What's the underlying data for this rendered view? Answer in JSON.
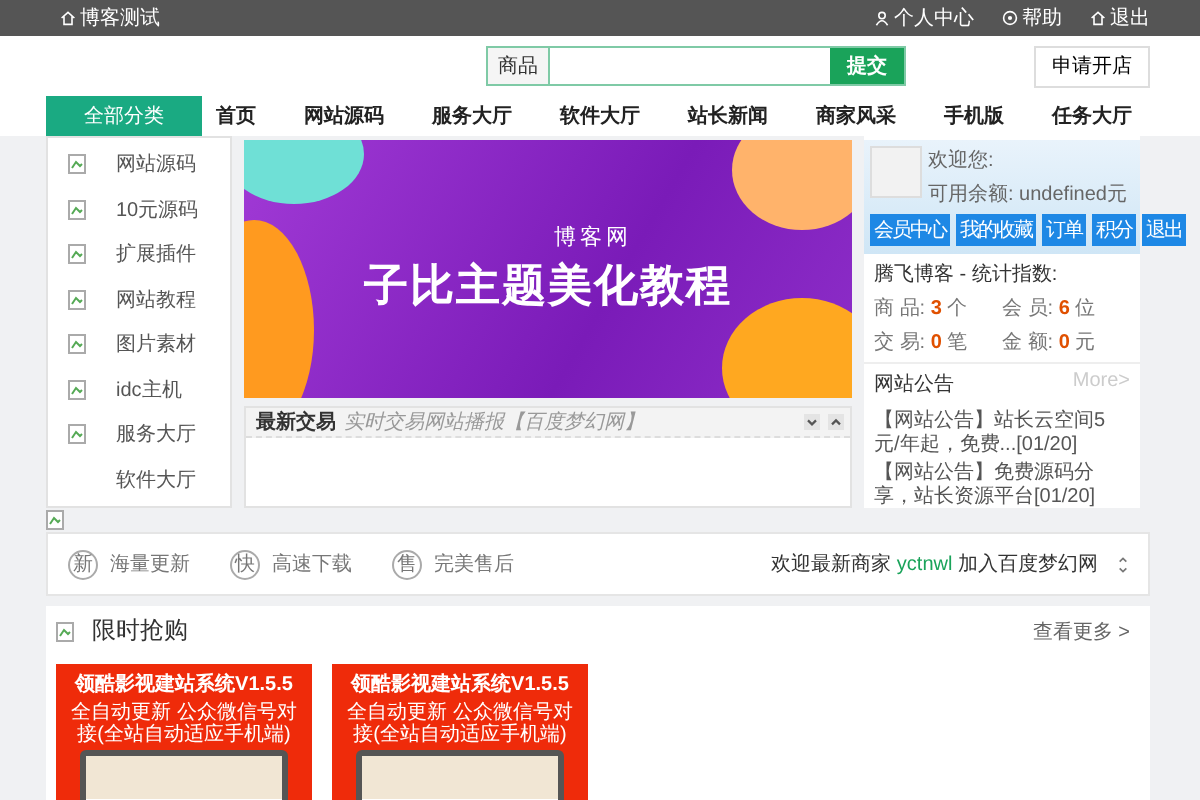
{
  "top_bar": {
    "site": "博客测试",
    "links": [
      {
        "kind": "user",
        "label": "个人中心"
      },
      {
        "kind": "help",
        "label": "帮助"
      },
      {
        "kind": "home",
        "label": "退出"
      }
    ]
  },
  "search": {
    "category": "商品",
    "submit": "提交"
  },
  "open_store": "申请开店",
  "nav": {
    "category_button": "全部分类",
    "items": [
      "首页",
      "网站源码",
      "服务大厅",
      "软件大厅",
      "站长新闻",
      "商家风采",
      "手机版",
      "任务大厅"
    ]
  },
  "sidebar": {
    "items": [
      {
        "label": "网站源码",
        "has_icon": true
      },
      {
        "label": "10元源码",
        "has_icon": true
      },
      {
        "label": "扩展插件",
        "has_icon": true
      },
      {
        "label": "网站教程",
        "has_icon": true
      },
      {
        "label": "图片素材",
        "has_icon": true
      },
      {
        "label": "idc主机",
        "has_icon": true
      },
      {
        "label": "服务大厅",
        "has_icon": true
      },
      {
        "label": "软件大厅",
        "has_icon": false
      }
    ]
  },
  "banner": {
    "subtitle": "博客网",
    "title": "子比主题美化教程"
  },
  "trades": {
    "title": "最新交易",
    "subtitle": "实时交易网站播报【百度梦幻网】"
  },
  "user_panel": {
    "greeting": "欢迎您:",
    "balance": "可用余额: undefined元",
    "buttons": [
      "会员中心",
      "我的收藏",
      "订单",
      "积分",
      "退出"
    ]
  },
  "stats": {
    "title": "腾飞博客 - 统计指数:",
    "items": [
      {
        "label": "商 品:",
        "value": "3",
        "unit": "个"
      },
      {
        "label": "会 员:",
        "value": "6",
        "unit": "位"
      },
      {
        "label": "交 易:",
        "value": "0",
        "unit": "笔"
      },
      {
        "label": "金 额:",
        "value": "0",
        "unit": "元"
      }
    ]
  },
  "notices": {
    "title": "网站公告",
    "more": "More>",
    "items": [
      "【网站公告】站长云空间5元/年起，免费...[01/20]",
      "【网站公告】免费源码分享，站长资源平台[01/20]"
    ]
  },
  "features": [
    {
      "badge": "新",
      "label": "海量更新"
    },
    {
      "badge": "快",
      "label": "高速下载"
    },
    {
      "badge": "售",
      "label": "完美售后"
    }
  ],
  "ticker": {
    "prefix": "欢迎最新商家",
    "merchant": "yctnwl",
    "suffix": "加入百度梦幻网"
  },
  "flash_sale": {
    "title": "限时抢购",
    "more": "查看更多 >",
    "products": [
      {
        "title": "领酷影视建站系统V1.5.5",
        "subtitle": "全自动更新  公众微信号对接(全站自动适应手机端)"
      },
      {
        "title": "领酷影视建站系统V1.5.5",
        "subtitle": "全自动更新  公众微信号对接(全站自动适应手机端)"
      }
    ]
  }
}
